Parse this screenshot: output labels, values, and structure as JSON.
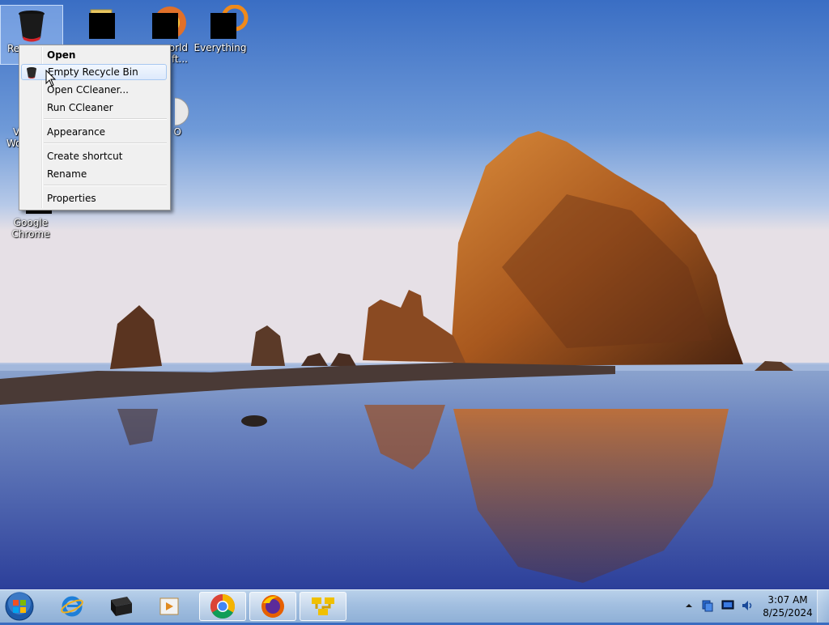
{
  "desktop": {
    "icons": [
      {
        "label": "Re",
        "icon": "recycle-bin-icon"
      },
      {
        "label": "",
        "icon": "folder-app-icon"
      },
      {
        "label": "orld",
        "label2": "ft...",
        "icon": "game-app-icon"
      },
      {
        "label": "Everything",
        "icon": "everything-search-icon"
      },
      {
        "label": "V",
        "label2": "Wo",
        "icon": "word-app-icon"
      },
      {
        "label": "O",
        "icon": "media-app-icon"
      },
      {
        "label": "Google",
        "label2": "Chrome",
        "icon": "chrome-icon"
      }
    ]
  },
  "context_menu": {
    "items": [
      {
        "label": "Open",
        "bold": true
      },
      {
        "label": "Empty Recycle Bin",
        "highlighted": true,
        "icon": "ccleaner-icon"
      },
      {
        "label": "Open CCleaner..."
      },
      {
        "label": "Run CCleaner"
      },
      {
        "label": "Appearance"
      },
      {
        "label": "Create shortcut"
      },
      {
        "label": "Rename"
      },
      {
        "label": "Properties"
      }
    ]
  },
  "taskbar": {
    "start": "windows-orb-icon",
    "pinned": [
      "internet-explorer-icon",
      "ccleaner-icon",
      "media-player-icon",
      "chrome-icon",
      "firefox-icon",
      "file-manager-icon"
    ],
    "active": [
      "chrome-icon",
      "firefox-icon",
      "file-manager-icon"
    ],
    "tray_icons": [
      "show-hidden-icons-icon",
      "network-icon",
      "display-icon",
      "volume-icon"
    ],
    "clock": {
      "time": "3:07 AM",
      "date": "8/25/2024"
    }
  }
}
